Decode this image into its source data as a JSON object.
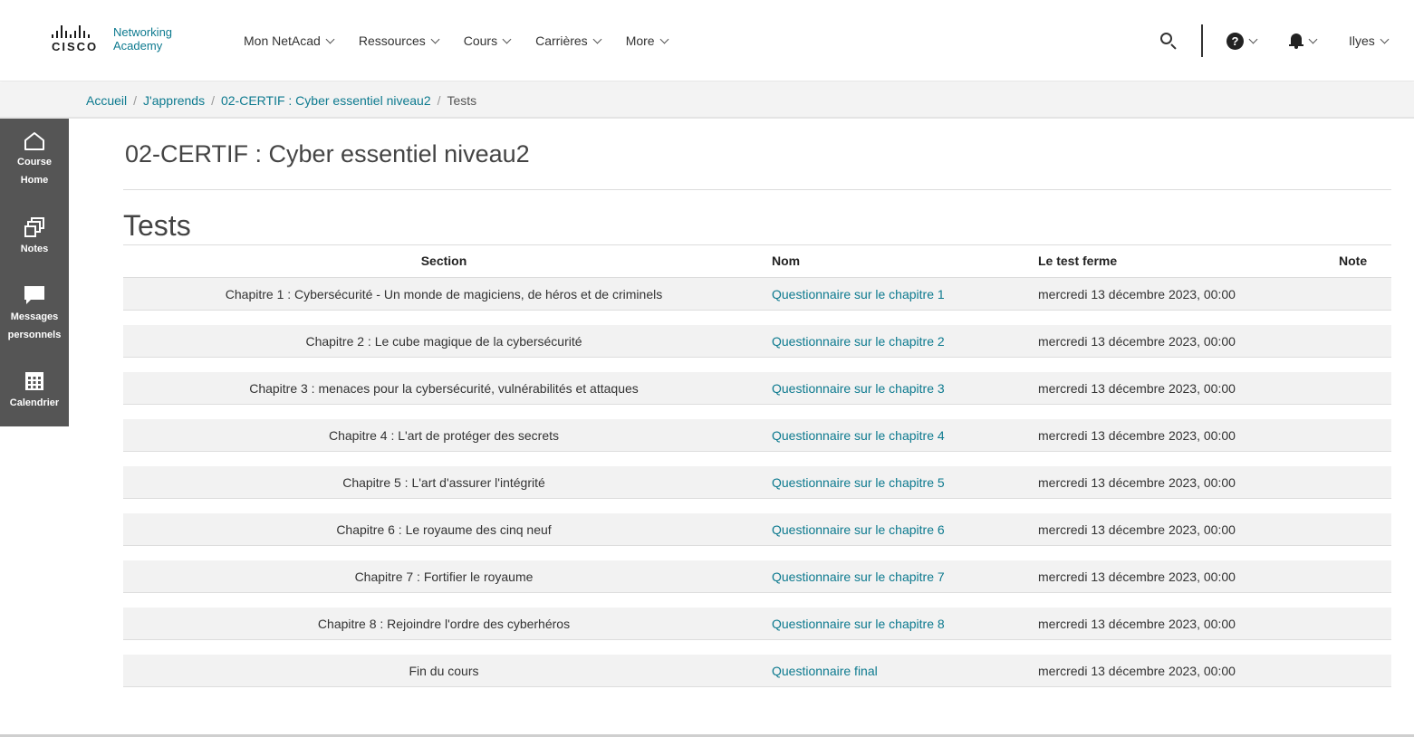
{
  "header": {
    "logo": {
      "wordmark": "CISCO",
      "line1": "Networking",
      "line2": "Academy"
    },
    "nav": [
      {
        "label": "Mon NetAcad"
      },
      {
        "label": "Ressources"
      },
      {
        "label": "Cours"
      },
      {
        "label": "Carrières"
      },
      {
        "label": "More"
      }
    ],
    "user_name": "Ilyes"
  },
  "breadcrumb": {
    "items": [
      "Accueil",
      "J'apprends",
      "02-CERTIF : Cyber essentiel niveau2"
    ],
    "current": "Tests",
    "separator": "/"
  },
  "sidebar": {
    "items": [
      {
        "line1": "Course",
        "line2": "Home",
        "icon": "home-icon"
      },
      {
        "line1": "Notes",
        "line2": "",
        "icon": "notes-icon"
      },
      {
        "line1": "Messages",
        "line2": "personnels",
        "icon": "message-icon"
      },
      {
        "line1": "Calendrier",
        "line2": "",
        "icon": "calendar-icon"
      }
    ]
  },
  "main": {
    "course_title": "02-CERTIF : Cyber essentiel niveau2",
    "page_title": "Tests",
    "table": {
      "headers": {
        "section": "Section",
        "nom": "Nom",
        "ferme": "Le test ferme",
        "note": "Note"
      },
      "rows": [
        {
          "section": "Chapitre 1 : Cybersécurité - Un monde de magiciens, de héros et de criminels",
          "nom": "Questionnaire sur le chapitre 1",
          "ferme": "mercredi 13 décembre 2023, 00:00"
        },
        {
          "section": "Chapitre 2 : Le cube magique de la cybersécurité",
          "nom": "Questionnaire sur le chapitre 2",
          "ferme": "mercredi 13 décembre 2023, 00:00"
        },
        {
          "section": "Chapitre 3 : menaces pour la cybersécurité, vulnérabilités et attaques",
          "nom": "Questionnaire sur le chapitre 3",
          "ferme": "mercredi 13 décembre 2023, 00:00"
        },
        {
          "section": "Chapitre 4 : L'art de protéger des secrets",
          "nom": "Questionnaire sur le chapitre 4",
          "ferme": "mercredi 13 décembre 2023, 00:00"
        },
        {
          "section": "Chapitre 5 : L'art d'assurer l'intégrité",
          "nom": "Questionnaire sur le chapitre 5",
          "ferme": "mercredi 13 décembre 2023, 00:00"
        },
        {
          "section": "Chapitre 6 : Le royaume des cinq neuf",
          "nom": "Questionnaire sur le chapitre 6",
          "ferme": "mercredi 13 décembre 2023, 00:00"
        },
        {
          "section": "Chapitre 7 : Fortifier le royaume",
          "nom": "Questionnaire sur le chapitre 7",
          "ferme": "mercredi 13 décembre 2023, 00:00"
        },
        {
          "section": "Chapitre 8 : Rejoindre l'ordre des cyberhéros",
          "nom": "Questionnaire sur le chapitre 8",
          "ferme": "mercredi 13 décembre 2023, 00:00"
        },
        {
          "section": "Fin du cours",
          "nom": "Questionnaire final",
          "ferme": "mercredi 13 décembre 2023, 00:00"
        }
      ]
    }
  },
  "colors": {
    "link": "#0d7a8f",
    "sidebar_bg": "#555555",
    "row_bg": "#f2f2f2"
  }
}
